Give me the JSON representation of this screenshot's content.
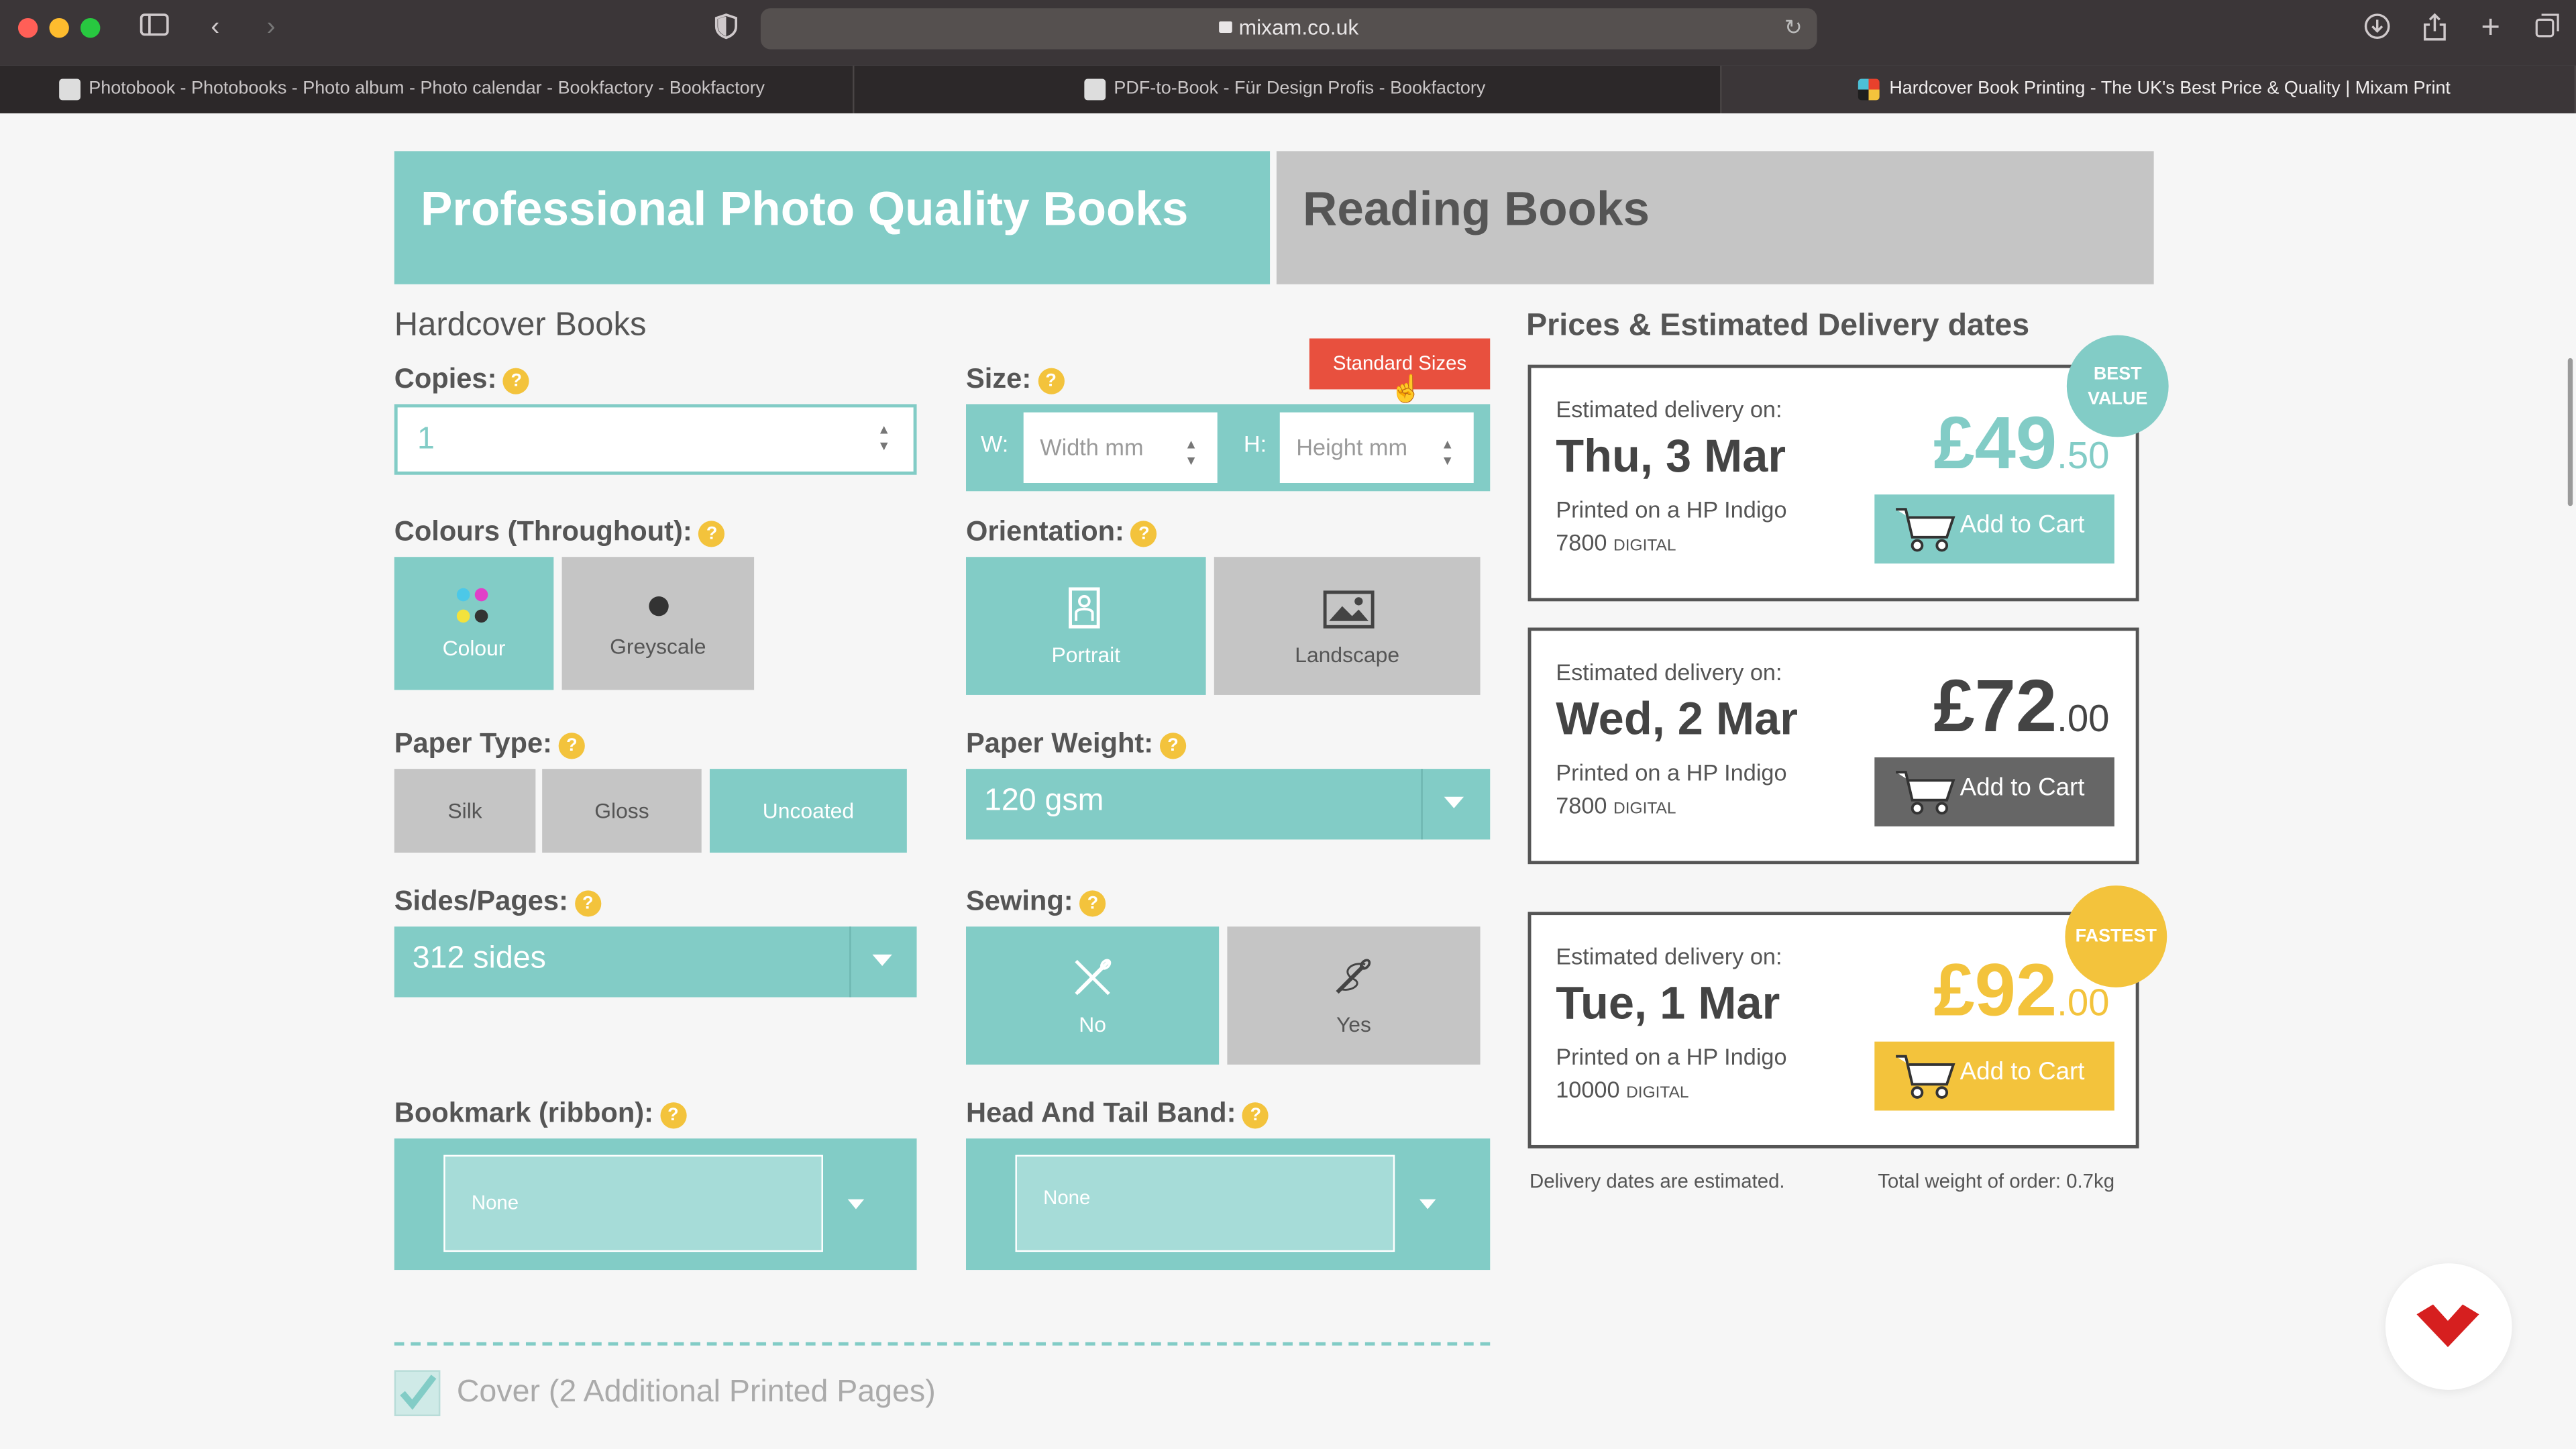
{
  "browser": {
    "url": "mixam.co.uk",
    "tabs": [
      {
        "label": "Photobook - Photobooks - Photo album - Photo calendar - Bookfactory - Bookfactory"
      },
      {
        "label": "PDF-to-Book - Für Design Profis - Bookfactory"
      },
      {
        "label": "Hardcover Book Printing - The UK's Best Price & Quality | Mixam Print"
      }
    ]
  },
  "category_tabs": {
    "photo": "Professional Photo Quality Books",
    "reading": "Reading Books"
  },
  "form": {
    "section_title": "Hardcover Books",
    "copies": {
      "label": "Copies:",
      "value": "1"
    },
    "size": {
      "label": "Size:",
      "standard_sizes": "Standard Sizes",
      "width_label": "W:",
      "width_placeholder": "Width mm",
      "height_label": "H:",
      "height_placeholder": "Height mm"
    },
    "colours": {
      "label": "Colours (Throughout):",
      "options": [
        "Colour",
        "Greyscale"
      ],
      "selected": "Colour"
    },
    "orientation": {
      "label": "Orientation:",
      "options": [
        "Portrait",
        "Landscape"
      ],
      "selected": "Portrait"
    },
    "paper_type": {
      "label": "Paper Type:",
      "options": [
        "Silk",
        "Gloss",
        "Uncoated"
      ],
      "selected": "Uncoated"
    },
    "paper_weight": {
      "label": "Paper Weight:",
      "value": "120 gsm"
    },
    "sides": {
      "label": "Sides/Pages:",
      "value": "312 sides"
    },
    "sewing": {
      "label": "Sewing:",
      "options": [
        "No",
        "Yes"
      ],
      "selected": "No"
    },
    "bookmark": {
      "label": "Bookmark (ribbon):",
      "value": "None"
    },
    "headband": {
      "label": "Head And Tail Band:",
      "value": "None"
    },
    "cover": {
      "label": "Cover (2 Additional Printed Pages)",
      "checked": true
    },
    "help_glyph": "?"
  },
  "prices": {
    "title": "Prices & Estimated Delivery dates",
    "est_label": "Estimated delivery on:",
    "add_to_cart": "Add to Cart",
    "options": [
      {
        "date": "Thu, 3 Mar",
        "printer": "Printed on a HP Indigo",
        "model": "7800",
        "model_suffix": "DIGITAL",
        "pounds": "£49",
        "pence": ".50",
        "badge_line1": "BEST",
        "badge_line2": "VALUE",
        "color": "#82ccc6"
      },
      {
        "date": "Wed, 2 Mar",
        "printer": "Printed on a HP Indigo",
        "model": "7800",
        "model_suffix": "DIGITAL",
        "pounds": "£72",
        "pence": ".00",
        "color": "#555555"
      },
      {
        "date": "Tue, 1 Mar",
        "printer": "Printed on a HP Indigo",
        "model": "10000",
        "model_suffix": "DIGITAL",
        "pounds": "£92",
        "pence": ".00",
        "badge_line1": "FASTEST",
        "color": "#f3c33c"
      }
    ],
    "note_left": "Delivery dates are estimated.",
    "note_right": "Total weight of order: 0.7kg"
  },
  "colors": {
    "teal": "#82ccc6",
    "grey": "#c5c5c5",
    "yellow": "#f3c33c",
    "red": "#e8503e",
    "dark": "#555555"
  }
}
